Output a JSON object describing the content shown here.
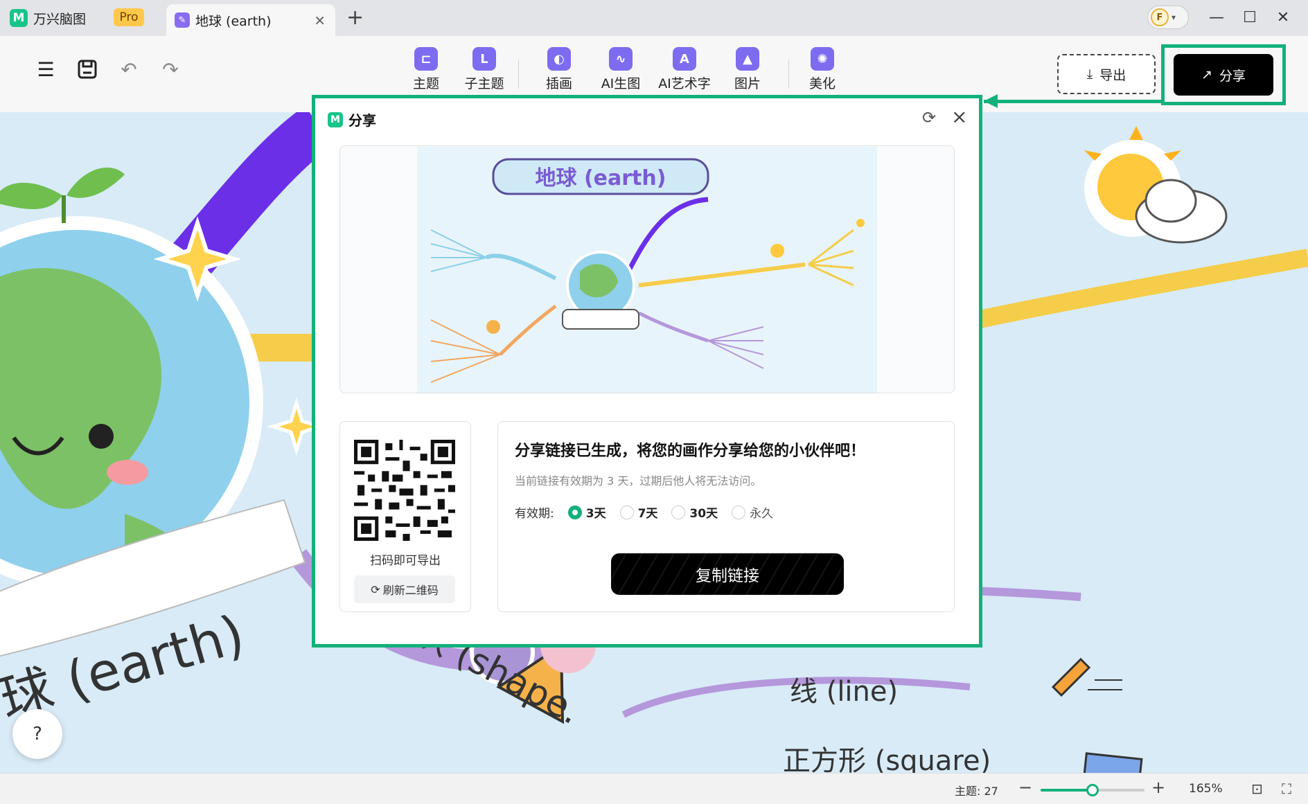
{
  "tabs": {
    "app_name": "万兴脑图",
    "pro_badge": "Pro",
    "doc_title": "地球 (earth)",
    "close": "×",
    "new_tab": "+"
  },
  "account": {
    "initial": "F"
  },
  "window": {
    "minimize": "—",
    "maximize": "☐",
    "close": "✕"
  },
  "toolbar": {
    "tools": [
      {
        "label": "主题"
      },
      {
        "label": "子主题"
      },
      {
        "label": "插画"
      },
      {
        "label": "AI生图"
      },
      {
        "label": "AI艺术字"
      },
      {
        "label": "图片"
      },
      {
        "label": "美化"
      }
    ],
    "export_label": "导出",
    "share_label": "分享"
  },
  "dialog": {
    "title": "分享",
    "preview_title": "地球 (earth)",
    "qr_caption": "扫码即可导出",
    "qr_refresh": "刷新二维码",
    "link_title": "分享链接已生成，将您的画作分享给您的小伙伴吧！",
    "link_sub": "当前链接有效期为 3 天，过期后他人将无法访问。",
    "validity_label": "有效期:",
    "options": [
      "3天",
      "7天",
      "30天",
      "永久"
    ],
    "selected_option": "3天",
    "copy_button": "复制链接"
  },
  "canvas": {
    "central_label": "球 (earth)",
    "shape_branch": "形状 (shape.",
    "line_label": "线 (line)",
    "square_label": "正方形 (square)"
  },
  "statusbar": {
    "topic_count": "主题: 27",
    "zoom_level": "165%",
    "zoom_value": 0.5
  },
  "help": "?",
  "colors": {
    "accent": "#13b17a",
    "purple": "#7d6cf0"
  }
}
